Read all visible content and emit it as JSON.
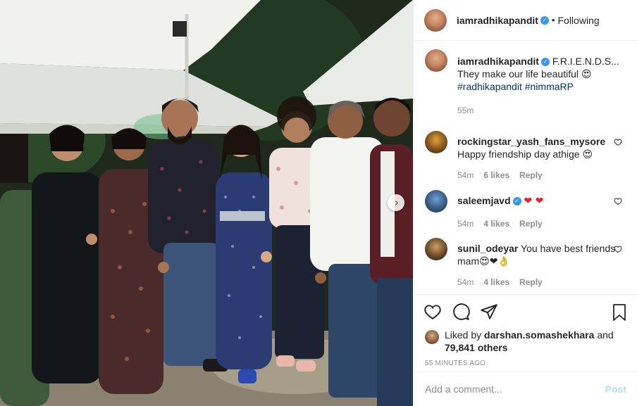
{
  "photo": {
    "alt": "Group photo of nine people posing at a night party under white tents"
  },
  "post_header": {
    "username": "iamradhikapandit",
    "separator": "•",
    "follow_status": "Following"
  },
  "caption": {
    "username": "iamradhikapandit",
    "text": "F.R.I.E.N.D.S...",
    "line2": "They make our life beautiful 😍",
    "hashtags": "#radhikapandit #nimmaRP",
    "time": "55m"
  },
  "comments": [
    {
      "username": "rockingstar_yash_fans_mysore",
      "text": "Happy friendship day athige 😍",
      "time": "54m",
      "likes": "6 likes",
      "reply": "Reply"
    },
    {
      "username": "saleemjavd",
      "text": "❤ ❤",
      "time": "54m",
      "likes": "4 likes",
      "reply": "Reply"
    },
    {
      "username": "sunil_odeyar",
      "text": "You have best friends mam😍❤👌",
      "time": "54m",
      "likes": "4 likes",
      "reply": "Reply"
    }
  ],
  "likes_summary": {
    "prefix": "Liked by ",
    "liker": "darshan.somashekhara",
    "mid": " and",
    "others": "79,841 others"
  },
  "timestamp": "55 MINUTES AGO",
  "add_comment": {
    "placeholder": "Add a comment...",
    "post_label": "Post"
  },
  "colors": {
    "verified": "#3897f0",
    "hashtag": "#00376b",
    "meta_gray": "#8e8e8e",
    "post_disabled": "#b2dffc"
  },
  "icons": [
    "heart-icon",
    "comment-icon",
    "share-icon",
    "bookmark-icon",
    "chevron-right-icon",
    "verified-icon"
  ]
}
